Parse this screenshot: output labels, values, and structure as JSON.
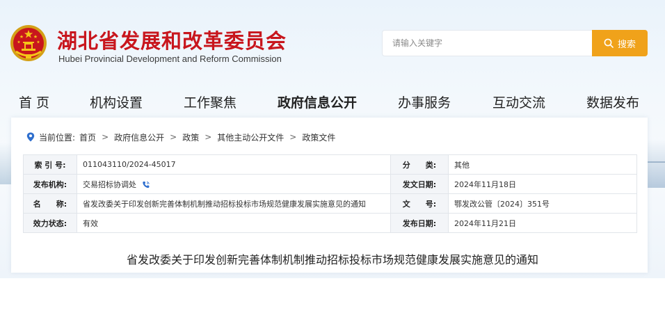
{
  "header": {
    "title": "湖北省发展和改革委员会",
    "subtitle": "Hubei Provincial Development and Reform Commission"
  },
  "search": {
    "placeholder": "请输入关键字",
    "button_label": "搜索",
    "button_color": "#f0a21a"
  },
  "colors": {
    "brand_red": "#c8161d",
    "accent_orange": "#f0a21a"
  },
  "nav": {
    "items": [
      {
        "label": "首 页"
      },
      {
        "label": "机构设置"
      },
      {
        "label": "工作聚焦"
      },
      {
        "label": "政府信息公开"
      },
      {
        "label": "办事服务"
      },
      {
        "label": "互动交流"
      },
      {
        "label": "数据发布"
      }
    ],
    "active": "政府信息公开"
  },
  "breadcrumb": {
    "prefix": "当前位置:",
    "items": [
      "首页",
      "政府信息公开",
      "政策",
      "其他主动公开文件",
      "政策文件"
    ],
    "separator": ">"
  },
  "info": {
    "index_label": "索 引 号:",
    "index_value": "011043110/2024-45017",
    "category_label": "分　　类:",
    "category_value": "其他",
    "publisher_label": "发布机构:",
    "publisher_value": "交易招标协调处",
    "issue_date_label": "发文日期:",
    "issue_date_value": "2024年11月18日",
    "name_label": "名　　称:",
    "name_value": "省发改委关于印发创新完善体制机制推动招标投标市场规范健康发展实施意见的通知",
    "doc_no_label": "文　　号:",
    "doc_no_value": "鄂发改公管〔2024〕351号",
    "status_label": "效力状态:",
    "status_value": "有效",
    "publish_date_label": "发布日期:",
    "publish_date_value": "2024年11月21日"
  },
  "document": {
    "title": "省发改委关于印发创新完善体制机制推动招标投标市场规范健康发展实施意见的通知"
  },
  "icons": {
    "emblem": "national-emblem-icon",
    "search": "search-icon",
    "location": "location-pin-icon",
    "phone": "phone-icon"
  }
}
